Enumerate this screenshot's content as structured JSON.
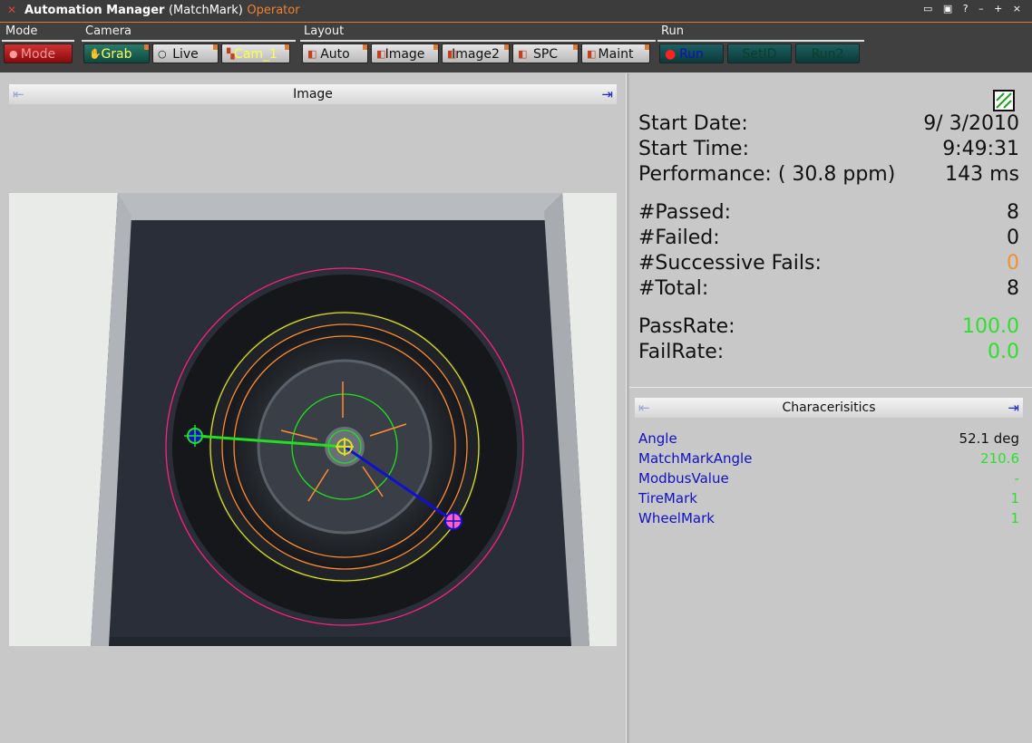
{
  "titlebar": {
    "app": "Automation Manager",
    "job": "(MatchMark)",
    "role": "Operator",
    "controls": "▭ ▣ ? – + ×"
  },
  "toolbar": {
    "groups": {
      "mode": "Mode",
      "camera": "Camera",
      "layout": "Layout",
      "run": "Run"
    },
    "mode": "Mode",
    "grab": "Grab",
    "live": "Live",
    "cam": "Cam_1",
    "auto": "Auto",
    "image": "Image",
    "image2": "Image2",
    "spc": "SPC",
    "maint": "Maint",
    "run": "Run",
    "setid": "SetID",
    "run2": "Run2"
  },
  "image_panel": {
    "title": "Image"
  },
  "stats": {
    "start_date_label": "Start Date:",
    "start_date": "9/ 3/2010",
    "start_time_label": "Start Time:",
    "start_time": "9:49:31",
    "performance_label": "Performance: ( 30.8 ppm)",
    "performance": "143 ms",
    "passed_label": "#Passed:",
    "passed": "8",
    "failed_label": "#Failed:",
    "failed": "0",
    "successive_label": "#Successive Fails:",
    "successive": "0",
    "total_label": "#Total:",
    "total": "8",
    "passrate_label": "PassRate:",
    "passrate": "100.0",
    "failrate_label": "FailRate:",
    "failrate": "0.0"
  },
  "characteristics": {
    "title": "Characerisitics",
    "rows": [
      {
        "name": "Angle",
        "value": "52.1 deg",
        "value_color": "#111111"
      },
      {
        "name": "MatchMarkAngle",
        "value": "210.6",
        "value_color": "#2ce02c"
      },
      {
        "name": "ModbusValue",
        "value": "-",
        "value_color": "#2ce02c"
      },
      {
        "name": "TireMark",
        "value": "1",
        "value_color": "#2ce02c"
      },
      {
        "name": "WheelMark",
        "value": "1",
        "value_color": "#2ce02c"
      }
    ]
  },
  "colors": {
    "accent": "#e07a30",
    "pass": "#2ce02c",
    "label_blue": "#1010c8"
  }
}
